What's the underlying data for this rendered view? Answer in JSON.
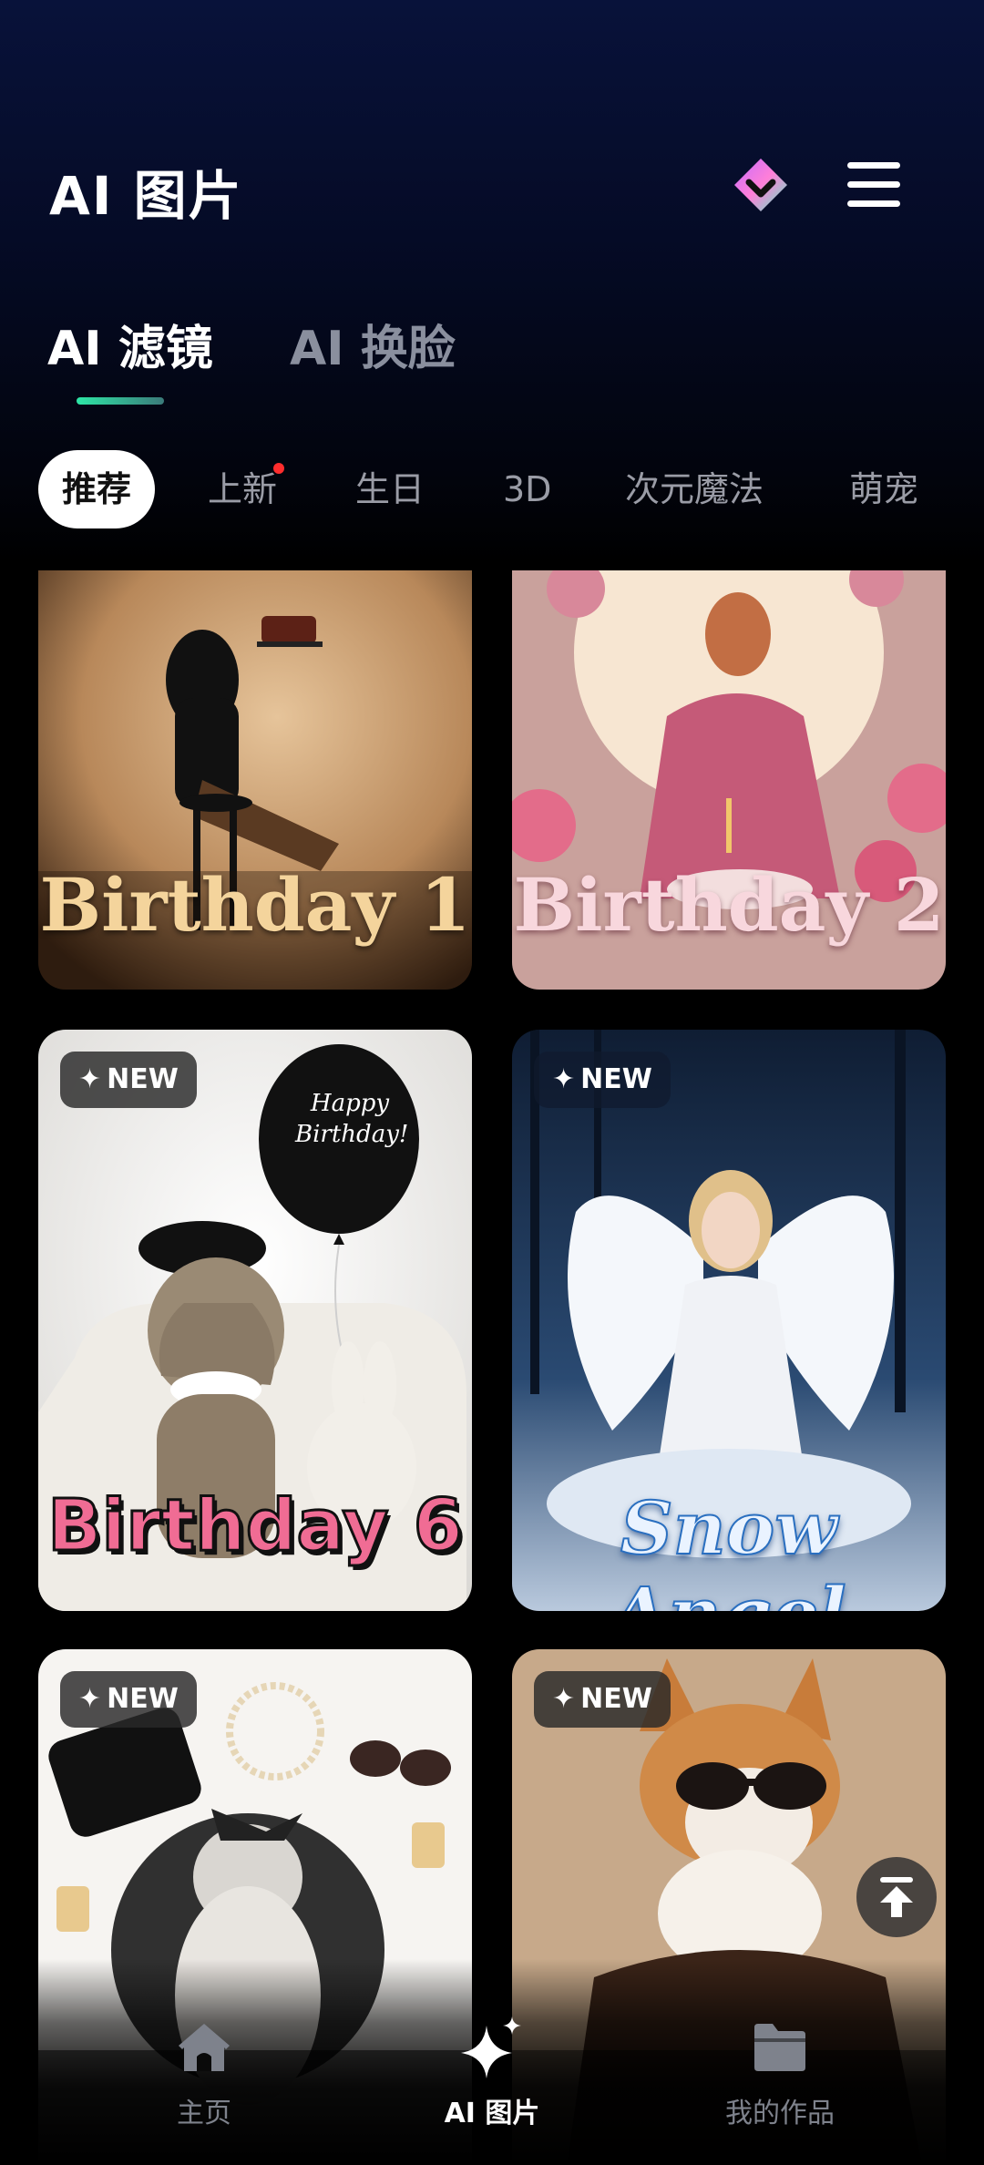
{
  "header": {
    "title": "AI 图片",
    "tabs": [
      {
        "label": "AI 滤镜",
        "active": true
      },
      {
        "label": "AI 换脸",
        "active": false
      }
    ]
  },
  "categories": [
    {
      "label": "推荐",
      "active": true
    },
    {
      "label": "上新",
      "has_dot": true
    },
    {
      "label": "生日"
    },
    {
      "label": "3D"
    },
    {
      "label": "次元魔法"
    },
    {
      "label": "萌宠"
    }
  ],
  "cards": [
    {
      "title": "Birthday 1",
      "badge": ""
    },
    {
      "title": "Birthday 2",
      "badge": ""
    },
    {
      "title": "Birthday 6",
      "badge": "NEW",
      "balloon_text": "Happy Birthday!"
    },
    {
      "title": "Snow Angel",
      "badge": "NEW"
    },
    {
      "title": "",
      "badge": "NEW"
    },
    {
      "title": "",
      "badge": "NEW"
    }
  ],
  "bottom_nav": [
    {
      "label": "主页",
      "icon": "home-icon",
      "active": false
    },
    {
      "label": "AI 图片",
      "icon": "sparkle-icon",
      "active": true
    },
    {
      "label": "我的作品",
      "icon": "folder-icon",
      "active": false
    }
  ],
  "colors": {
    "accent": "#2ee6a6",
    "badge_dot": "#ff2d2d",
    "header_bg": "#08123a"
  }
}
